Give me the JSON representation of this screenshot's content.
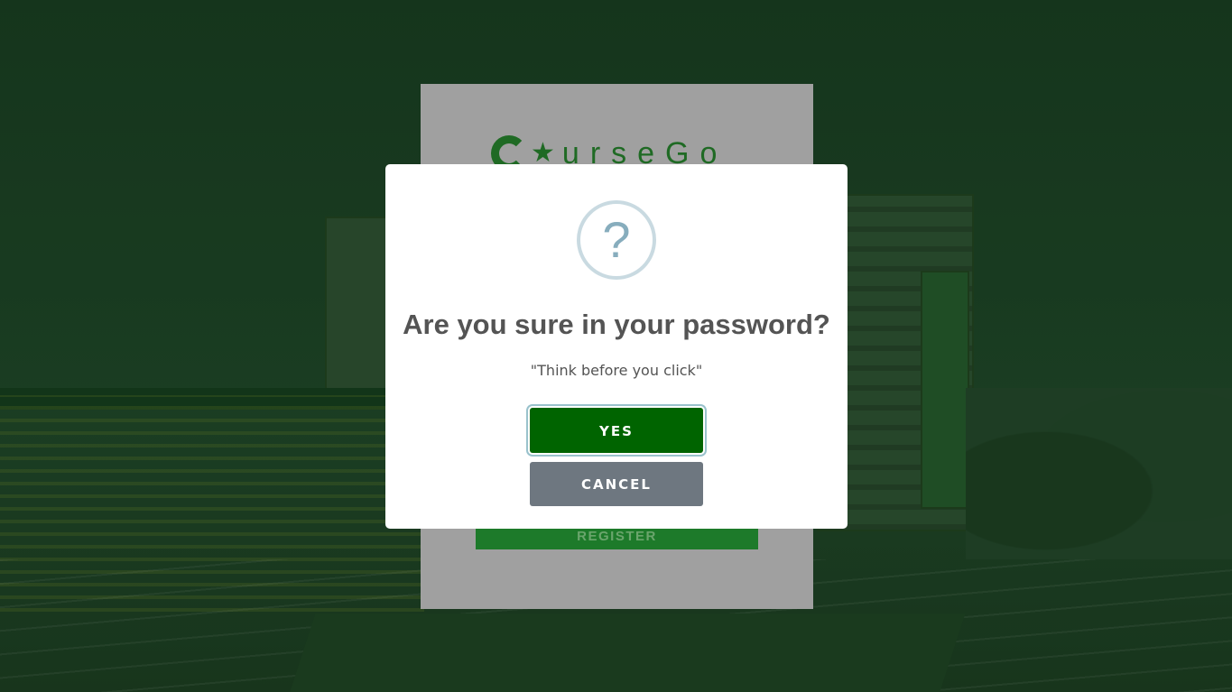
{
  "login": {
    "logo_text": "urseGo",
    "register_label": "REGISTER"
  },
  "dialog": {
    "icon": "question-icon",
    "icon_glyph": "?",
    "title": "Are you sure in your password?",
    "message": "\"Think before you click\"",
    "confirm_label": "YES",
    "cancel_label": "CANCEL"
  },
  "colors": {
    "confirm_button": "#006400",
    "cancel_button": "#6e7780",
    "brand_green": "#1f6a24",
    "title_text": "#545454"
  }
}
